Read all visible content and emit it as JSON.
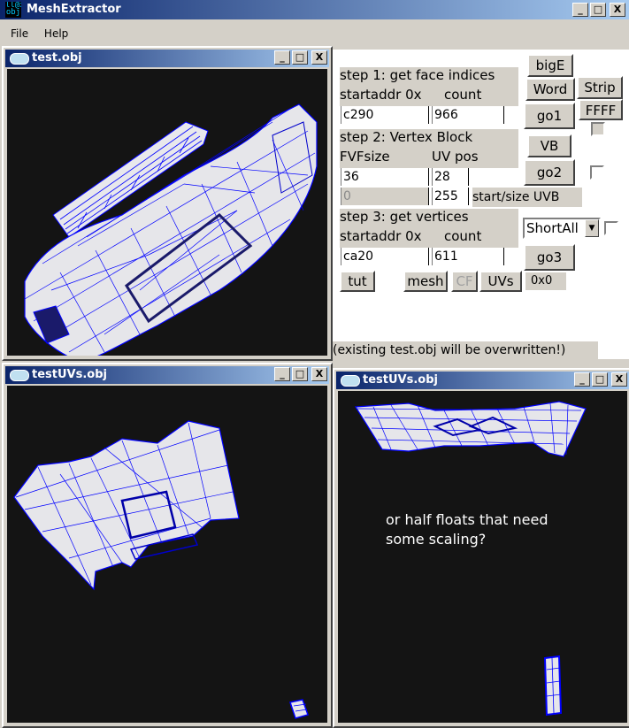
{
  "app": {
    "title": "MeshExtractor",
    "icon_text": "ll@x obj",
    "minimize": "_",
    "maximize": "□",
    "close": "X"
  },
  "menu": [
    "File",
    "Help"
  ],
  "windows": {
    "main": {
      "title": "test.obj"
    },
    "uv_left": {
      "title": "testUVs.obj"
    },
    "uv_right": {
      "title": "testUVs.obj",
      "annotation_line1": "or half floats that need",
      "annotation_line2": "some scaling?"
    }
  },
  "panel": {
    "step1": {
      "title": "step 1: get face indices",
      "col_a": "startaddr 0x",
      "col_b": "count",
      "startaddr": "c290",
      "count": "966"
    },
    "step2": {
      "title": "step 2: Vertex Block",
      "col_a": "FVFsize",
      "col_b": "UV pos",
      "fvfsize": "36",
      "uvpos": "28",
      "start": "0",
      "size": "255",
      "start_size_label": "start/size UVB"
    },
    "step3": {
      "title": "step 3: get vertices",
      "col_a": "startaddr 0x",
      "col_b": "count",
      "startaddr": "ca20",
      "count": "611"
    },
    "buttons": {
      "bigE": "bigE",
      "word": "Word",
      "strip": "Strip",
      "ffff": "FFFF",
      "go1": "go1",
      "vb": "VB",
      "go2": "go2",
      "go3": "go3",
      "tut": "tut",
      "mesh": "mesh",
      "cf": "CF",
      "uvs": "UVs"
    },
    "combo_value": "ShortAll",
    "status_value": "0x0",
    "warning": "(existing test.obj will be overwritten!)"
  },
  "colors": {
    "wire": "#0000ff",
    "surface": "#e8e8ec",
    "viewport_bg": "#141414",
    "titlebar_start": "#0a246a",
    "titlebar_end": "#a6caf0"
  }
}
